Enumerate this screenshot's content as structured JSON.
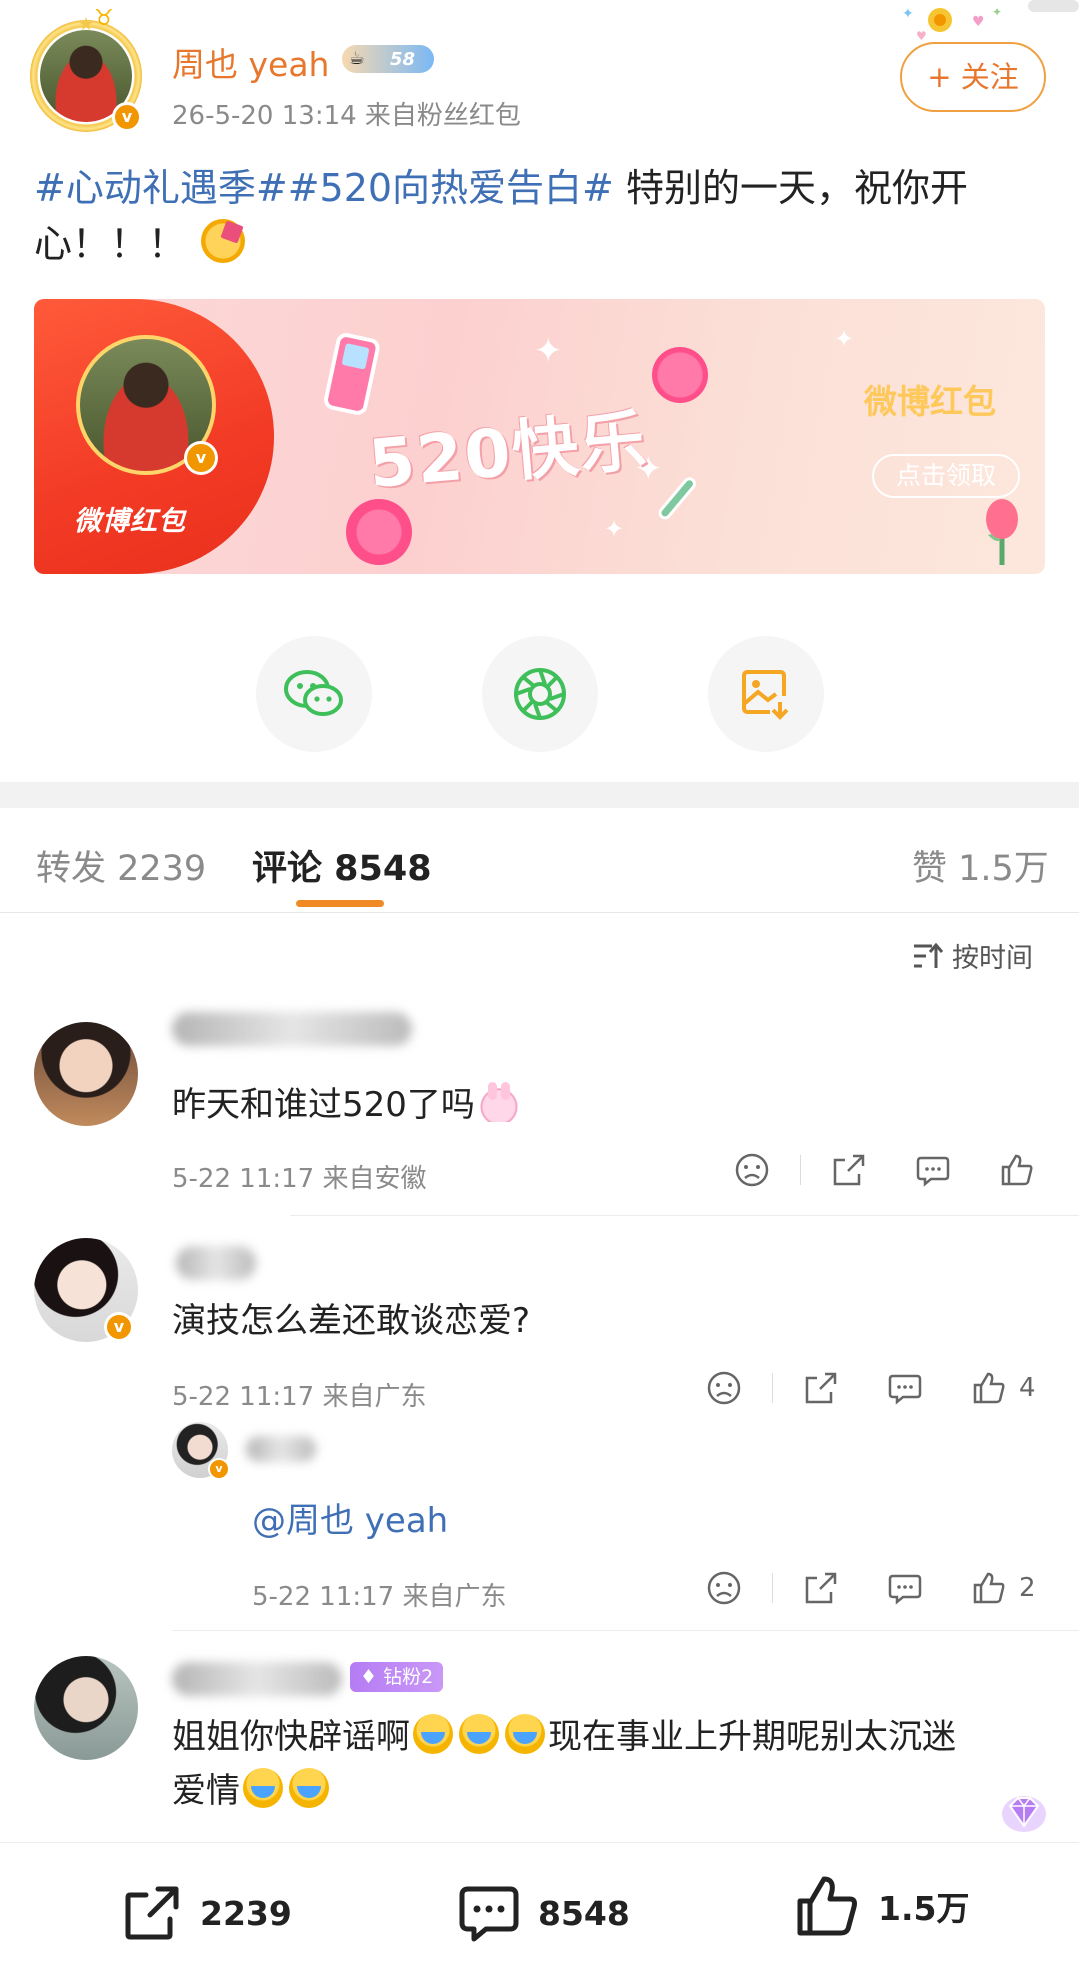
{
  "post": {
    "author": "周也 yeah",
    "level": "58",
    "meta": "26-5-20 13:14  来自粉丝红包",
    "follow_label": "+ 关注",
    "topic1": "#心动礼遇季#",
    "topic2": "#520向热爱告白#",
    "text": " 特别的一天，祝你开心！！！",
    "emoji": "partying-face"
  },
  "card": {
    "brand_left": "微博红包",
    "title": "520快乐",
    "brand_right": "微博红包",
    "claim_label": "点击领取"
  },
  "share": {
    "wechat": "wechat-icon",
    "moments": "moments-icon",
    "save_image": "save-image-icon"
  },
  "tabs": {
    "repost": "转发 2239",
    "comments": "评论 8548",
    "likes": "赞 1.5万"
  },
  "sort": {
    "label": "按时间"
  },
  "comments": [
    {
      "text": "昨天和谁过520了吗",
      "emoji": "bunny",
      "meta": "5-22 11:17  来自安徽",
      "likes": ""
    },
    {
      "text": "演技怎么差还敢谈恋爱?",
      "meta": "5-22 11:17  来自广东",
      "likes": "4",
      "reply": {
        "mention": "@周也 yeah",
        "meta": "5-22 11:17  来自广东",
        "likes": "2"
      }
    },
    {
      "fan_badge": "钻粉2",
      "text_a": "姐姐你快辟谣啊",
      "text_b": "现在事业上升期呢别太沉迷",
      "text_c": "爱情",
      "emoji": "loudly-crying-face",
      "meta": ""
    }
  ],
  "bottom_bar": {
    "reposts": "2239",
    "comments": "8548",
    "likes": "1.5万"
  },
  "colors": {
    "accent": "#e8772e",
    "topic_link": "#3f6fb5",
    "tab_underline": "#f08a24",
    "card_red": "#f23a25",
    "verify": "#f29600"
  }
}
